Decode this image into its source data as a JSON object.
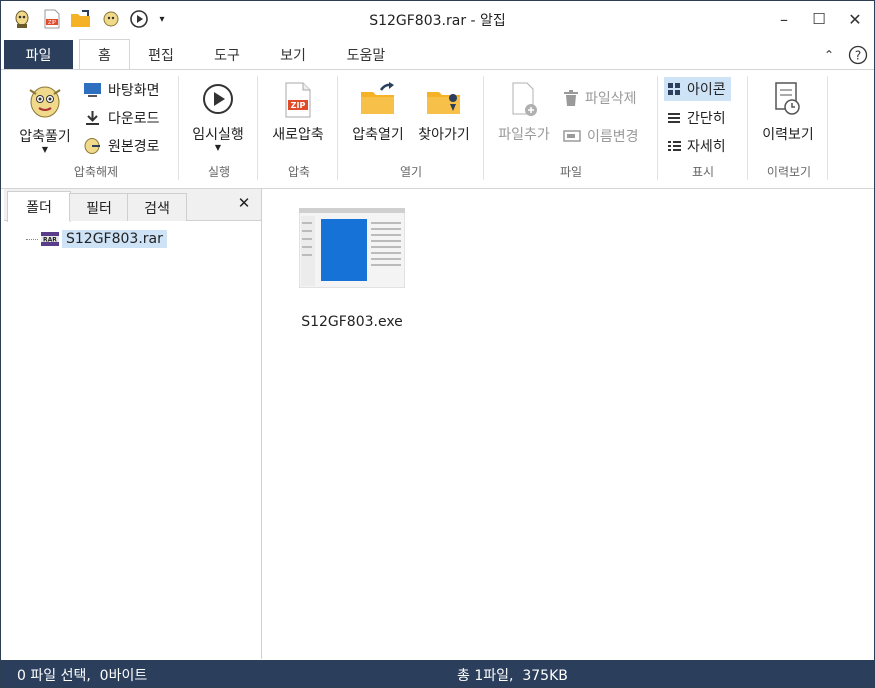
{
  "window": {
    "title": "S12GF803.rar - 알집",
    "quick_access": [
      "alzip-logo-icon",
      "new-zip-icon",
      "open-folder-icon",
      "extract-icon",
      "run-icon",
      "customize-arrow-icon"
    ],
    "controls": {
      "minimize": "–",
      "maximize": "☐",
      "close": "✕"
    }
  },
  "tabs": {
    "file": "파일",
    "items": [
      "홈",
      "편집",
      "도구",
      "보기",
      "도움말"
    ],
    "active": "홈",
    "ribbon_collapse": "⌃",
    "help": "?"
  },
  "ribbon": {
    "extract": {
      "group_label": "압축해제",
      "main_label": "압축풀기",
      "desktop": "바탕화면",
      "download": "다운로드",
      "original_path": "원본경로"
    },
    "run": {
      "group_label": "실행",
      "temp_run": "임시실행"
    },
    "compress": {
      "group_label": "압축",
      "new_compress": "새로압축"
    },
    "open": {
      "group_label": "열기",
      "open_archive": "압축열기",
      "go_to": "찾아가기"
    },
    "file": {
      "group_label": "파일",
      "add_file": "파일추가",
      "delete_file": "파일삭제",
      "rename": "이름변경"
    },
    "view": {
      "group_label": "표시",
      "icon": "아이콘",
      "simple": "간단히",
      "detail": "자세히",
      "selected": "아이콘"
    },
    "history": {
      "group_label": "이력보기",
      "history": "이력보기"
    }
  },
  "left_panel": {
    "tabs": [
      "폴더",
      "필터",
      "검색"
    ],
    "active_tab": "폴더",
    "close": "✕",
    "tree": [
      {
        "label": "S12GF803.rar",
        "icon": "rar-archive-icon",
        "selected": true
      }
    ]
  },
  "files": [
    {
      "name": "S12GF803.exe",
      "icon": "exe-thumbnail-icon"
    }
  ],
  "status": {
    "left": "0 파일 선택,  0바이트",
    "center": "총 1파일,  375KB"
  },
  "colors": {
    "accent_dark": "#2b3f5c",
    "selection": "#cfe3f7",
    "folder_yellow": "#f5b227",
    "zip_red": "#e04b2a"
  }
}
